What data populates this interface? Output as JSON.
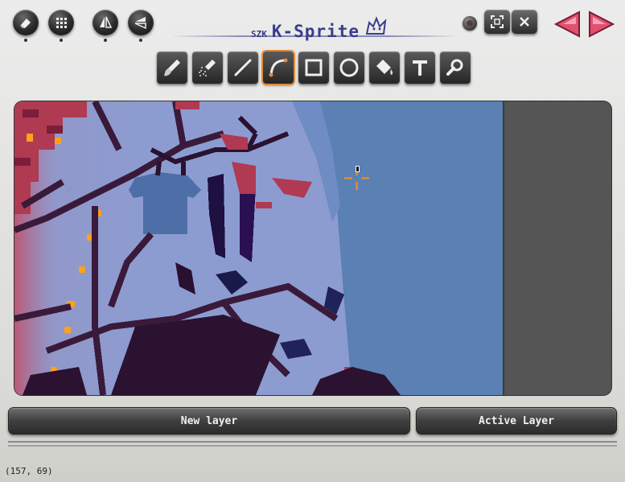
{
  "app": {
    "title_prefix": "SZK",
    "title": "K-Sprite"
  },
  "top_buttons": {
    "left": [
      {
        "name": "eraser-button",
        "icon": "eraser-icon"
      },
      {
        "name": "grid-button",
        "icon": "grid-icon"
      },
      {
        "name": "flip-horizontal-button",
        "icon": "flip-horizontal-icon"
      },
      {
        "name": "flip-vertical-button",
        "icon": "flip-vertical-icon"
      }
    ],
    "right": [
      {
        "name": "record-button",
        "icon": "dot-icon"
      },
      {
        "name": "fullscreen-button",
        "icon": "fullscreen-icon"
      },
      {
        "name": "close-button",
        "icon": "close-icon"
      },
      {
        "name": "prev-button",
        "icon": "arrow-left-icon"
      },
      {
        "name": "next-button",
        "icon": "arrow-right-icon"
      }
    ]
  },
  "toolbar": {
    "tools": [
      {
        "name": "brush",
        "icon": "brush-icon"
      },
      {
        "name": "spray",
        "icon": "spray-icon"
      },
      {
        "name": "line",
        "icon": "line-icon"
      },
      {
        "name": "curve",
        "icon": "curve-icon",
        "active": true
      },
      {
        "name": "rectangle",
        "icon": "rectangle-icon"
      },
      {
        "name": "ellipse",
        "icon": "ellipse-icon"
      },
      {
        "name": "fill",
        "icon": "paint-bucket-icon"
      },
      {
        "name": "text",
        "icon": "text-icon"
      },
      {
        "name": "zoom",
        "icon": "magnifier-icon"
      }
    ]
  },
  "colors": {
    "accent": "#e38a3a",
    "title": "#3c3c8c",
    "sky_light": "#8c9cd0",
    "sky_blue": "#5a80b4",
    "branch_dark": "#3a1a3a",
    "branch_red": "#b03a52",
    "light_orange": "#ffa020"
  },
  "buttons": {
    "new_layer": "New layer",
    "active_layer": "Active Layer"
  },
  "status": {
    "coordinates": "(157, 69)"
  }
}
